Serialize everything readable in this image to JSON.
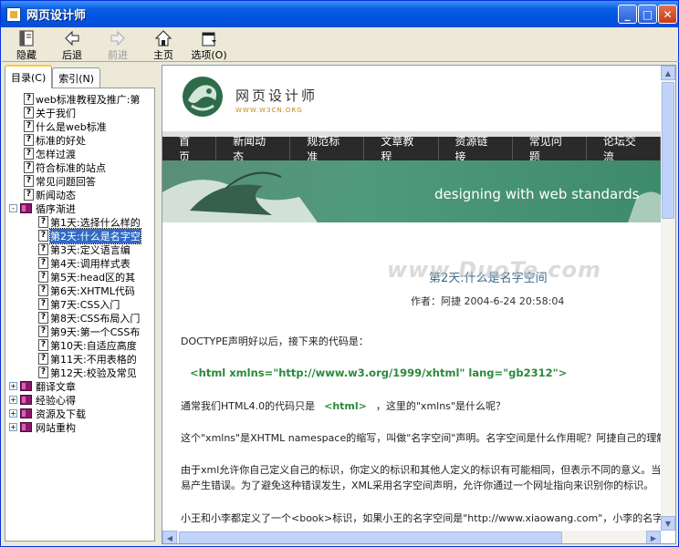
{
  "window": {
    "title": "网页设计师"
  },
  "toolbar": {
    "hide": "隐藏",
    "back": "后退",
    "forward": "前进",
    "home": "主页",
    "options": "选项(O)"
  },
  "tabs": {
    "contents": "目录(C)",
    "index": "索引(N)"
  },
  "tree": [
    {
      "label": "web标准教程及推广:第",
      "type": "page",
      "level": 1
    },
    {
      "label": "关于我们",
      "type": "page",
      "level": 1
    },
    {
      "label": "什么是web标准",
      "type": "page",
      "level": 1
    },
    {
      "label": "标准的好处",
      "type": "page",
      "level": 1
    },
    {
      "label": "怎样过渡",
      "type": "page",
      "level": 1
    },
    {
      "label": "符合标准的站点",
      "type": "page",
      "level": 1
    },
    {
      "label": "常见问题回答",
      "type": "page",
      "level": 1
    },
    {
      "label": "新闻动态",
      "type": "page",
      "level": 1
    },
    {
      "label": "循序渐进",
      "type": "book-open",
      "level": 0,
      "expander": "-"
    },
    {
      "label": "第1天:选择什么样的",
      "type": "page",
      "level": 2
    },
    {
      "label": "第2天:什么是名字空",
      "type": "page",
      "level": 2,
      "selected": true
    },
    {
      "label": "第3天:定义语言编",
      "type": "page",
      "level": 2
    },
    {
      "label": "第4天:调用样式表",
      "type": "page",
      "level": 2
    },
    {
      "label": "第5天:head区的其",
      "type": "page",
      "level": 2
    },
    {
      "label": "第6天:XHTML代码",
      "type": "page",
      "level": 2
    },
    {
      "label": "第7天:CSS入门",
      "type": "page",
      "level": 2
    },
    {
      "label": "第8天:CSS布局入门",
      "type": "page",
      "level": 2
    },
    {
      "label": "第9天:第一个CSS布",
      "type": "page",
      "level": 2
    },
    {
      "label": "第10天:自适应高度",
      "type": "page",
      "level": 2
    },
    {
      "label": "第11天:不用表格的",
      "type": "page",
      "level": 2
    },
    {
      "label": "第12天:校验及常见",
      "type": "page",
      "level": 2
    },
    {
      "label": "翻译文章",
      "type": "book",
      "level": 0,
      "expander": "+"
    },
    {
      "label": "经验心得",
      "type": "book",
      "level": 0,
      "expander": "+"
    },
    {
      "label": "资源及下载",
      "type": "book",
      "level": 0,
      "expander": "+"
    },
    {
      "label": "网站重构",
      "type": "book",
      "level": 0,
      "expander": "+"
    }
  ],
  "site": {
    "logo_title": "网页设计师",
    "logo_sub": "WWW.W3CN.ORG",
    "nav": [
      "首页",
      "新闻动态",
      "规范标准",
      "文章教程",
      "资源链接",
      "常见问题",
      "论坛交流"
    ],
    "banner": "designing with web standards"
  },
  "article": {
    "title": "第2天:什么是名字空间",
    "author": "作者：阿捷  2004-6-24 20:58:04",
    "p1": "DOCTYPE声明好以后，接下来的代码是：",
    "code1": "<html xmlns=\"http://www.w3.org/1999/xhtml\" lang=\"gb2312\">",
    "p2a": "通常我们HTML4.0的代码只是",
    "code2": "<html>",
    "p2b": "，这里的\"xmlns\"是什么呢？",
    "p3": "这个\"xmlns\"是XHTML namespace的缩写，叫做\"名字空间\"声明。名字空间是什么作用呢？阿捷自己的理解",
    "p4": "由于xml允许你自己定义自己的标识，你定义的标识和其他人定义的标识有可能相同，但表示不同的意义。当",
    "p5": "易产生错误。为了避免这种错误发生，XML采用名字空间声明，允许你通过一个网址指向来识别你的标识。",
    "p6": "小王和小李都定义了一个<book>标识，如果小王的名字空间是\"http://www.xiaowang.com\"，小李的名字"
  },
  "watermark": "www.DuoTe.com"
}
